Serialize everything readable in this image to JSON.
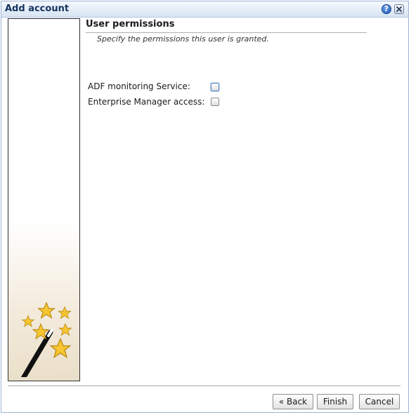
{
  "dialog": {
    "title": "Add account",
    "help_icon_text": "?"
  },
  "section": {
    "title": "User permissions",
    "description": "Specify the permissions this user is granted."
  },
  "permissions": [
    {
      "label": "ADF monitoring Service:",
      "checked": false
    },
    {
      "label": "Enterprise Manager access:",
      "checked": false
    }
  ],
  "buttons": {
    "back": "« Back",
    "finish": "Finish",
    "cancel": "Cancel"
  },
  "colors": {
    "titlebar_text": "#15325e",
    "star": "#f7c531",
    "wand": "#111111"
  },
  "icons": {
    "help": "help-icon",
    "close": "close-icon",
    "wizard": "magic-wand-stars-icon"
  }
}
